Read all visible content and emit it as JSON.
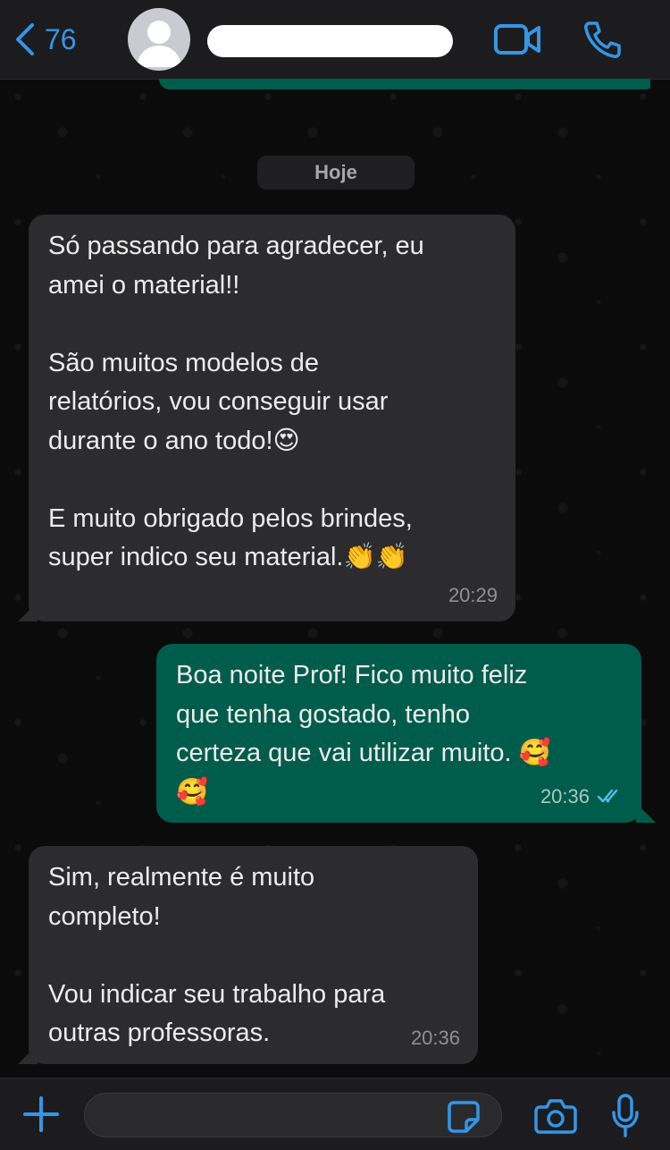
{
  "header": {
    "back_count": "76",
    "contact_name": "",
    "icons": {
      "back": "chevron-left-icon",
      "video": "video-icon",
      "call": "phone-icon",
      "avatar": "person-icon"
    }
  },
  "date_separator": "Hoje",
  "messages": [
    {
      "direction": "incoming",
      "text": "Só passando para agradecer, eu\namei o material!!\n\nSão muitos modelos de\nrelatórios, vou conseguir usar\ndurante o ano todo!😍\n\nE muito obrigado pelos brindes,\nsuper indico seu material.👏👏",
      "time": "20:29"
    },
    {
      "direction": "outgoing",
      "text": "Boa noite Prof! Fico muito feliz\nque tenha gostado, tenho\ncerteza que vai utilizar muito. 🥰\n🥰",
      "time": "20:36",
      "status": "read"
    },
    {
      "direction": "incoming",
      "text": "Sim, realmente é muito\ncompleto!\n\nVou indicar seu trabalho para\noutras professoras.",
      "time": "20:36"
    }
  ],
  "input_bar": {
    "message_value": "",
    "icons": {
      "plus": "plus-icon",
      "sticker": "sticker-icon",
      "camera": "camera-icon",
      "mic": "microphone-icon"
    }
  },
  "colors": {
    "accent": "#3396e8",
    "incoming_bubble": "#2c2c2e",
    "outgoing_bubble": "#005c4b",
    "background": "#0b0b0b",
    "read_ticks": "#53bdeb"
  }
}
